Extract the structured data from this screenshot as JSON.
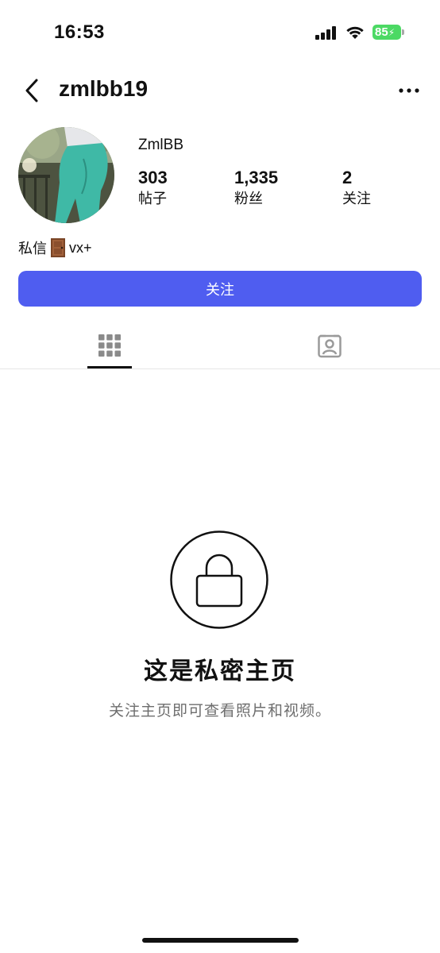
{
  "status_bar": {
    "time": "16:53",
    "battery": "85"
  },
  "header": {
    "username": "zmlbb19"
  },
  "profile": {
    "display_name": "ZmlBB",
    "stats": [
      {
        "value": "303",
        "label": "帖子"
      },
      {
        "value": "1,335",
        "label": "粉丝"
      },
      {
        "value": "2",
        "label": "关注"
      }
    ],
    "bio_prefix": "私信",
    "bio_suffix": "vx+"
  },
  "follow_button": "关注",
  "private": {
    "title": "这是私密主页",
    "subtitle": "关注主页即可查看照片和视频。"
  },
  "colors": {
    "accent": "#4f5df0",
    "battery": "#4cd964"
  },
  "icons": [
    "back-arrow-icon",
    "more-icon",
    "grid-icon",
    "tagged-icon",
    "lock-icon",
    "door-icon"
  ]
}
